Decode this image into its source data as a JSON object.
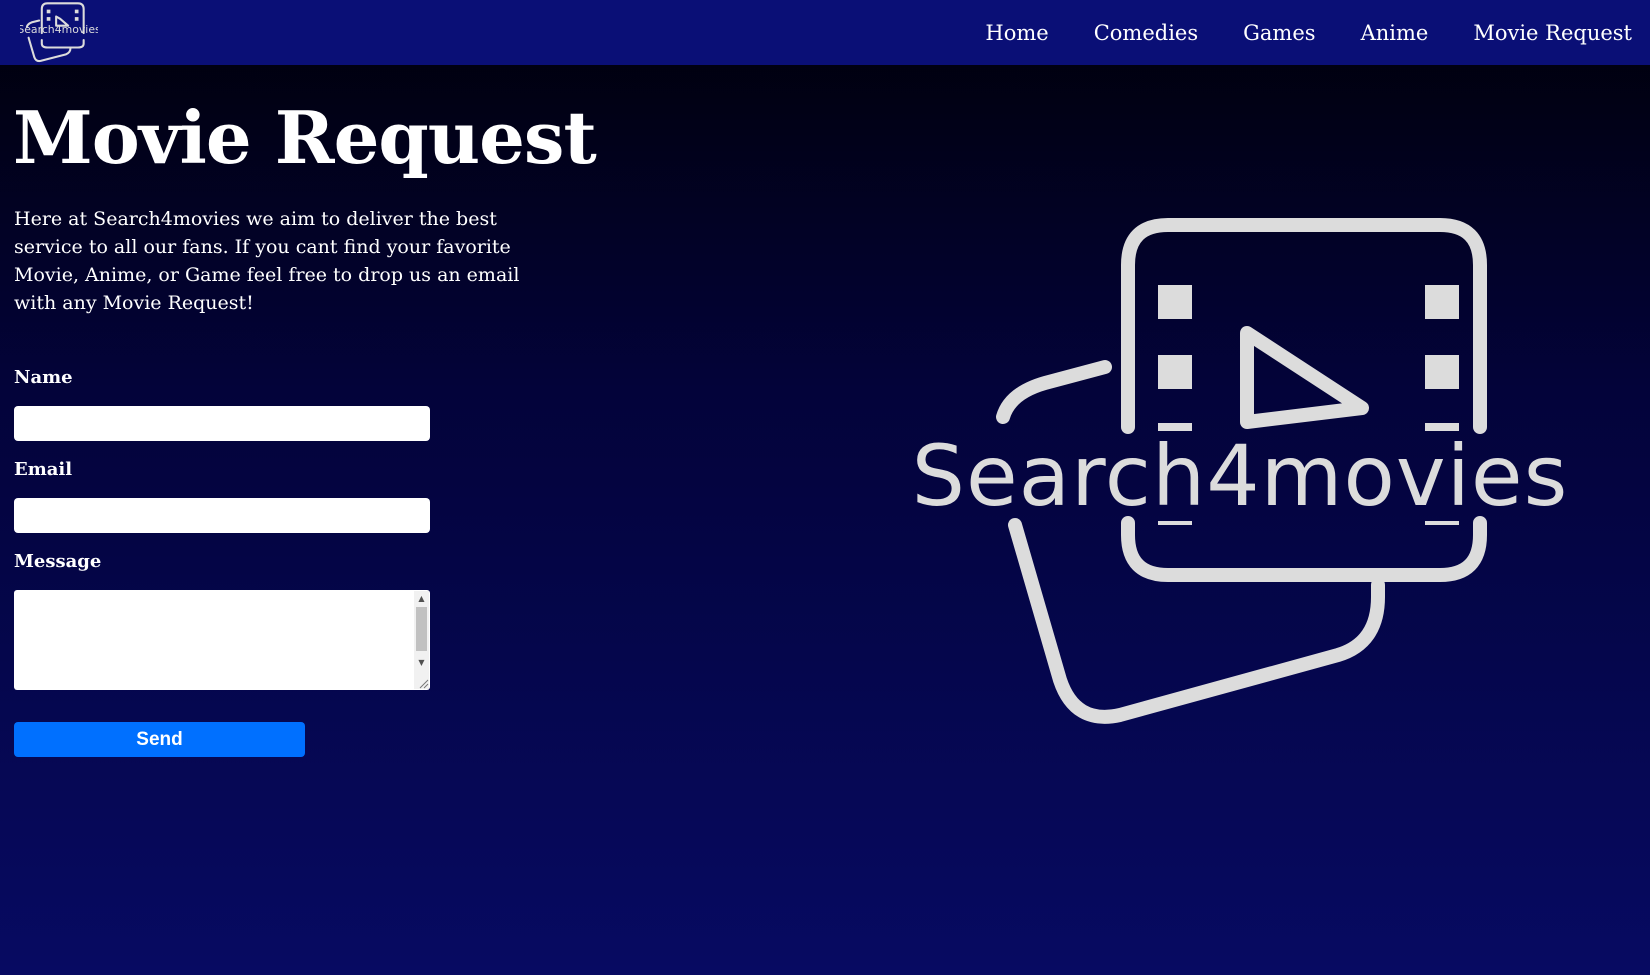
{
  "nav": {
    "logo_text": "Search4movies",
    "links": [
      {
        "label": "Home"
      },
      {
        "label": "Comedies"
      },
      {
        "label": "Games"
      },
      {
        "label": "Anime"
      },
      {
        "label": "Movie Request"
      }
    ]
  },
  "main": {
    "title": "Movie Request",
    "intro": "Here at Search4movies we aim to deliver the best service to all our fans. If you cant find your favorite Movie, Anime, or Game feel free to drop us an email with any Movie Request!"
  },
  "form": {
    "name_label": "Name",
    "name_value": "",
    "email_label": "Email",
    "email_value": "",
    "message_label": "Message",
    "message_value": "",
    "send_label": "Send"
  },
  "hero": {
    "logo_text": "Search4movies"
  },
  "colors": {
    "nav_background": "#0a0f76",
    "page_background_top": "#000008",
    "page_background_bottom": "#070a62",
    "send_button": "#0070ff",
    "logo_stroke": "#dcdcdc"
  },
  "icons": [
    "film-play-logo-icon",
    "scroll-up-arrow-icon",
    "scroll-down-arrow-icon",
    "resize-grip-icon"
  ]
}
